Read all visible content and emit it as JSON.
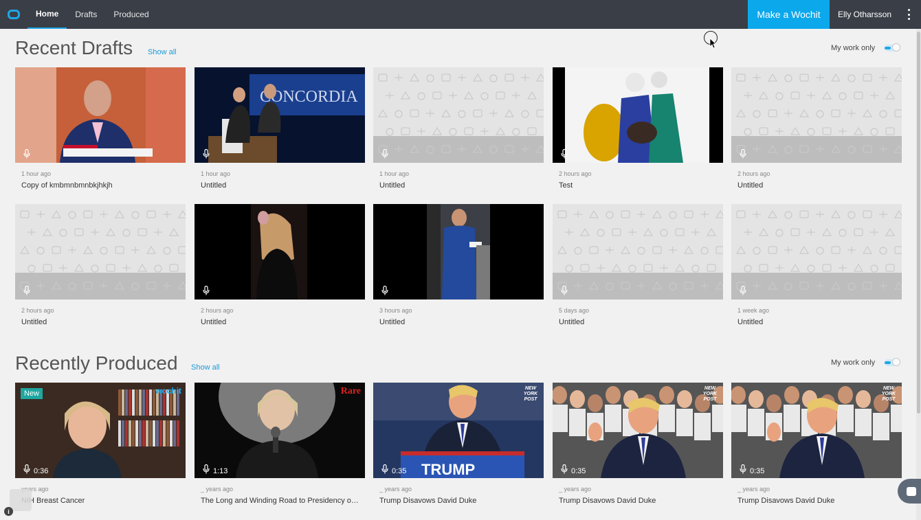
{
  "nav": {
    "tabs": [
      {
        "label": "Home",
        "active": true
      },
      {
        "label": "Drafts",
        "active": false
      },
      {
        "label": "Produced",
        "active": false
      }
    ],
    "make_label": "Make a Wochit",
    "user": "Elly Otharsson"
  },
  "drafts": {
    "title": "Recent Drafts",
    "show_all": "Show all",
    "my_work": "My work only",
    "my_work_on": true,
    "items": [
      {
        "time": "1 hour ago",
        "title": "Copy of kmbmnbmnbkjhkjh",
        "thumb": "news-interview"
      },
      {
        "time": "1 hour ago",
        "title": "Untitled",
        "thumb": "stage-interview"
      },
      {
        "time": "1 hour ago",
        "title": "Untitled",
        "thumb": "placeholder"
      },
      {
        "time": "2 hours ago",
        "title": "Test",
        "thumb": "skiers"
      },
      {
        "time": "2 hours ago",
        "title": "Untitled",
        "thumb": "placeholder"
      },
      {
        "time": "2 hours ago",
        "title": "Untitled",
        "thumb": "placeholder"
      },
      {
        "time": "2 hours ago",
        "title": "Untitled",
        "thumb": "couple-dark"
      },
      {
        "time": "3 hours ago",
        "title": "Untitled",
        "thumb": "man-suit-street"
      },
      {
        "time": "5 days ago",
        "title": "Untitled",
        "thumb": "placeholder"
      },
      {
        "time": "1 week ago",
        "title": "Untitled",
        "thumb": "placeholder"
      }
    ]
  },
  "produced": {
    "title": "Recently Produced",
    "show_all": "Show all",
    "my_work": "My work only",
    "my_work_on": true,
    "items": [
      {
        "time": "years ago",
        "title": "NIH Breast Cancer",
        "duration": "0:36",
        "badge": "New",
        "brand": "wochit",
        "thumb": "woman-bookshelf"
      },
      {
        "time": "_ years ago",
        "title": "The Long and Winding Road to Presidency of Hillary Clinton",
        "duration": "1:13",
        "brand": "Rare",
        "thumb": "woman-mic"
      },
      {
        "time": "_ years ago",
        "title": "Trump Disavows David Duke",
        "duration": "0:35",
        "brand": "NEW YORK POST",
        "thumb": "podium"
      },
      {
        "time": "_ years ago",
        "title": "Trump Disavows David Duke",
        "duration": "0:35",
        "brand": "NEW YORK POST",
        "thumb": "crowd"
      },
      {
        "time": "_ years ago",
        "title": "Trump Disavows David Duke",
        "duration": "0:35",
        "brand": "NEW YORK POST",
        "thumb": "crowd"
      }
    ]
  }
}
